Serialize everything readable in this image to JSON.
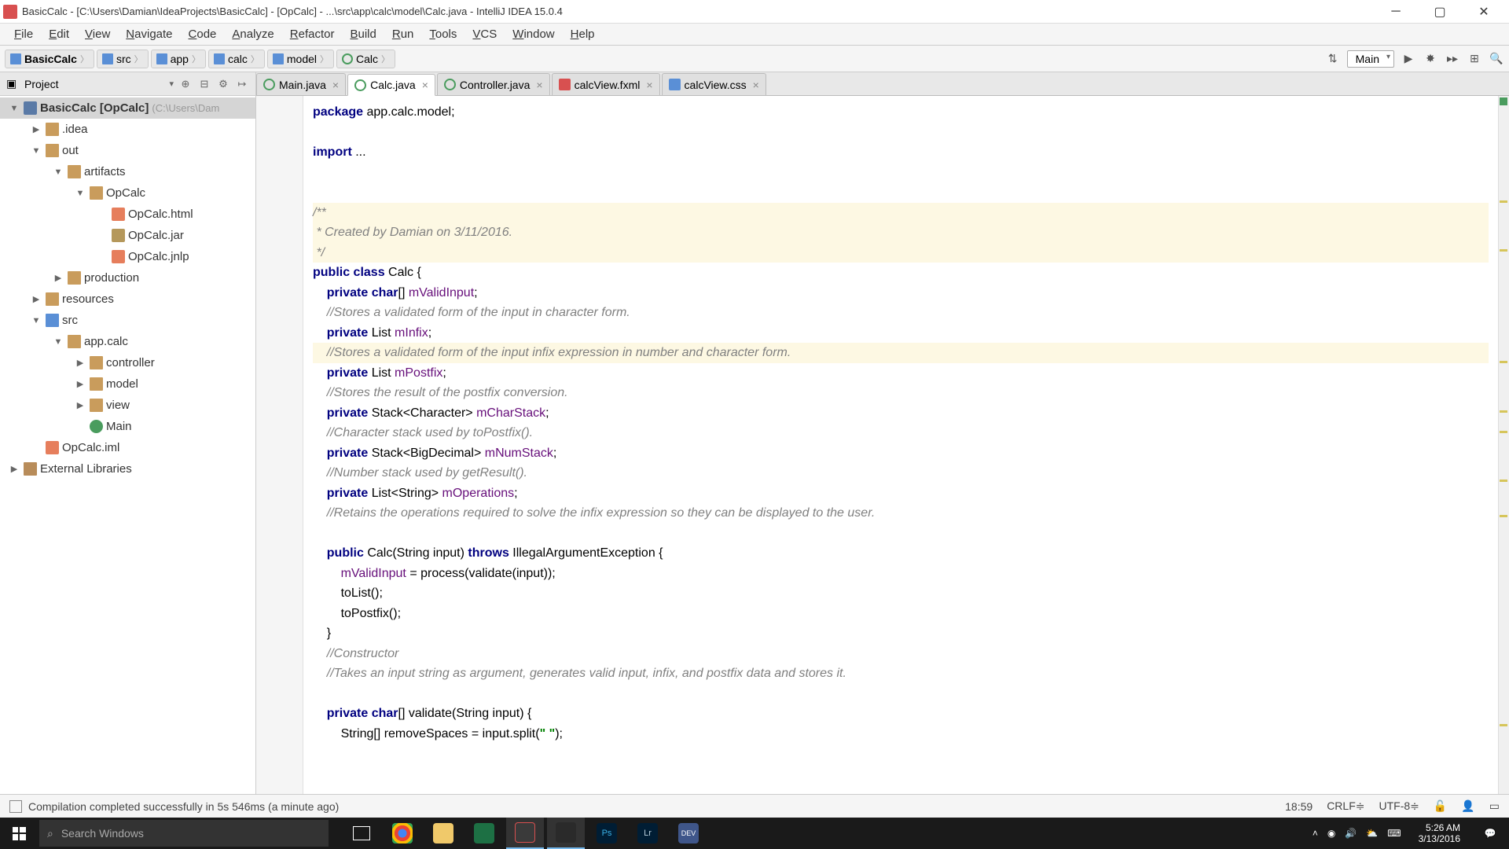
{
  "titlebar": {
    "text": "BasicCalc - [C:\\Users\\Damian\\IdeaProjects\\BasicCalc] - [OpCalc] - ...\\src\\app\\calc\\model\\Calc.java - IntelliJ IDEA 15.0.4"
  },
  "menubar": [
    "File",
    "Edit",
    "View",
    "Navigate",
    "Code",
    "Analyze",
    "Refactor",
    "Build",
    "Run",
    "Tools",
    "VCS",
    "Window",
    "Help"
  ],
  "breadcrumbs": [
    {
      "label": "BasicCalc",
      "bold": true,
      "icon": "folder"
    },
    {
      "label": "src",
      "icon": "folder"
    },
    {
      "label": "app",
      "icon": "folder"
    },
    {
      "label": "calc",
      "icon": "folder"
    },
    {
      "label": "model",
      "icon": "folder"
    },
    {
      "label": "Calc",
      "icon": "class"
    }
  ],
  "run_config": "Main",
  "project_panel": {
    "title": "Project"
  },
  "tree": [
    {
      "depth": 0,
      "arrow": "▼",
      "icon": "module",
      "label": "BasicCalc [OpCalc]",
      "hint": "(C:\\Users\\Dam",
      "selected": true
    },
    {
      "depth": 1,
      "arrow": "▶",
      "icon": "folder",
      "label": ".idea"
    },
    {
      "depth": 1,
      "arrow": "▼",
      "icon": "folder",
      "label": "out"
    },
    {
      "depth": 2,
      "arrow": "▼",
      "icon": "folder",
      "label": "artifacts"
    },
    {
      "depth": 3,
      "arrow": "▼",
      "icon": "folder",
      "label": "OpCalc"
    },
    {
      "depth": 4,
      "arrow": "",
      "icon": "html",
      "label": "OpCalc.html"
    },
    {
      "depth": 4,
      "arrow": "",
      "icon": "jar",
      "label": "OpCalc.jar"
    },
    {
      "depth": 4,
      "arrow": "",
      "icon": "html",
      "label": "OpCalc.jnlp"
    },
    {
      "depth": 2,
      "arrow": "▶",
      "icon": "folder",
      "label": "production"
    },
    {
      "depth": 1,
      "arrow": "▶",
      "icon": "folder",
      "label": "resources"
    },
    {
      "depth": 1,
      "arrow": "▼",
      "icon": "folder-src",
      "label": "src"
    },
    {
      "depth": 2,
      "arrow": "▼",
      "icon": "package",
      "label": "app.calc"
    },
    {
      "depth": 3,
      "arrow": "▶",
      "icon": "package",
      "label": "controller"
    },
    {
      "depth": 3,
      "arrow": "▶",
      "icon": "package",
      "label": "model"
    },
    {
      "depth": 3,
      "arrow": "▶",
      "icon": "package",
      "label": "view"
    },
    {
      "depth": 3,
      "arrow": "",
      "icon": "class",
      "label": "Main"
    },
    {
      "depth": 1,
      "arrow": "",
      "icon": "html",
      "label": "OpCalc.iml"
    },
    {
      "depth": 0,
      "arrow": "▶",
      "icon": "lib",
      "label": "External Libraries"
    }
  ],
  "tabs": [
    {
      "label": "Main.java",
      "icon": "java",
      "active": false
    },
    {
      "label": "Calc.java",
      "icon": "java",
      "active": true
    },
    {
      "label": "Controller.java",
      "icon": "java",
      "active": false
    },
    {
      "label": "calcView.fxml",
      "icon": "fxml",
      "active": false
    },
    {
      "label": "calcView.css",
      "icon": "css",
      "active": false
    }
  ],
  "code_lines": [
    {
      "t": "package",
      "text": "<kw>package</kw> app.calc.model;"
    },
    {
      "t": "blank",
      "text": ""
    },
    {
      "t": "import",
      "text": "<kw>import</kw> ..."
    },
    {
      "t": "blank",
      "text": ""
    },
    {
      "t": "blank",
      "text": ""
    },
    {
      "t": "doc",
      "text": "<doc>/**</doc>",
      "hl": true
    },
    {
      "t": "doc",
      "text": "<doc> * Created by Damian on 3/11/2016.</doc>",
      "hl": true
    },
    {
      "t": "doc",
      "text": "<doc> */</doc>",
      "hl": true
    },
    {
      "t": "code",
      "text": "<kw>public class</kw> Calc {"
    },
    {
      "t": "code",
      "text": "    <kw>private char</kw>[] <fld>mValidInput</fld>;"
    },
    {
      "t": "cmt",
      "text": "    <cmt>//Stores a validated form of the input in character form.</cmt>"
    },
    {
      "t": "code",
      "text": "    <kw>private</kw> List <fld>mInfix</fld>;"
    },
    {
      "t": "cmt",
      "text": "    <cmt>//Stores a validated form of the input infix expression in number and character form.</cmt>",
      "hl": true
    },
    {
      "t": "code",
      "text": "    <kw>private</kw> List <fld>mPostfix</fld>;"
    },
    {
      "t": "cmt",
      "text": "    <cmt>//Stores the result of the postfix conversion.</cmt>"
    },
    {
      "t": "code",
      "text": "    <kw>private</kw> Stack&lt;Character&gt; <fld>mCharStack</fld>;"
    },
    {
      "t": "cmt",
      "text": "    <cmt>//Character stack used by toPostfix().</cmt>"
    },
    {
      "t": "code",
      "text": "    <kw>private</kw> Stack&lt;BigDecimal&gt; <fld>mNumStack</fld>;"
    },
    {
      "t": "cmt",
      "text": "    <cmt>//Number stack used by getResult().</cmt>"
    },
    {
      "t": "code",
      "text": "    <kw>private</kw> List&lt;String&gt; <fld>mOperations</fld>;"
    },
    {
      "t": "cmt",
      "text": "    <cmt>//Retains the operations required to solve the infix expression so they can be displayed to the user.</cmt>"
    },
    {
      "t": "blank",
      "text": ""
    },
    {
      "t": "code",
      "text": "    <kw>public</kw> Calc(String input) <kw>throws</kw> IllegalArgumentException {"
    },
    {
      "t": "code",
      "text": "        <fld>mValidInput</fld> = process(validate(input));"
    },
    {
      "t": "code",
      "text": "        toList();"
    },
    {
      "t": "code",
      "text": "        toPostfix();"
    },
    {
      "t": "code",
      "text": "    }"
    },
    {
      "t": "cmt",
      "text": "    <cmt>//Constructor</cmt>"
    },
    {
      "t": "cmt",
      "text": "    <cmt>//Takes an input string as argument, generates valid input, infix, and postfix data and stores it.</cmt>"
    },
    {
      "t": "blank",
      "text": ""
    },
    {
      "t": "code",
      "text": "    <kw>private char</kw>[] validate(String input) {"
    },
    {
      "t": "code",
      "text": "        String[] removeSpaces = input.split(<str>\" \"</str>);"
    }
  ],
  "status": {
    "message": "Compilation completed successfully in 5s 546ms (a minute ago)",
    "cursor": "18:59",
    "line_ending": "CRLF",
    "encoding": "UTF-8"
  },
  "taskbar": {
    "search_placeholder": "Search Windows",
    "time": "5:26 AM",
    "date": "3/13/2016"
  }
}
